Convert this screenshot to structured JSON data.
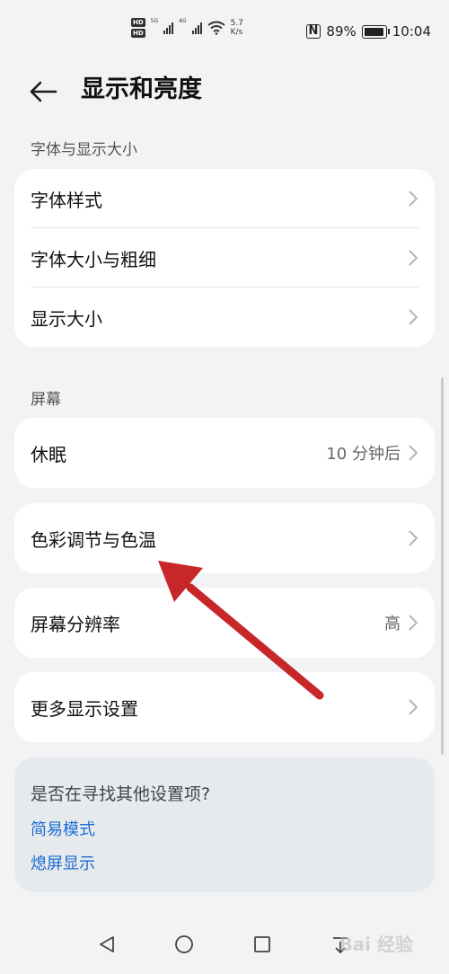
{
  "status_bar": {
    "hd1": "HD",
    "hd2": "HD",
    "net1": "5G",
    "net2": "4G",
    "speed_value": "5.7",
    "speed_unit": "K/s",
    "battery": "89%",
    "time": "10:04"
  },
  "header": {
    "title": "显示和亮度"
  },
  "section_font": {
    "label": "字体与显示大小",
    "items": [
      {
        "label": "字体样式"
      },
      {
        "label": "字体大小与粗细"
      },
      {
        "label": "显示大小"
      }
    ]
  },
  "section_screen": {
    "label": "屏幕",
    "sleep": {
      "label": "休眠",
      "value": "10 分钟后"
    },
    "color": {
      "label": "色彩调节与色温"
    },
    "resolution": {
      "label": "屏幕分辨率",
      "value": "高"
    },
    "more": {
      "label": "更多显示设置"
    }
  },
  "search_card": {
    "question": "是否在寻找其他设置项?",
    "links": [
      "简易模式",
      "熄屏显示"
    ]
  },
  "watermark": "Bai 经验",
  "colors": {
    "link": "#1a6bd6",
    "annotation_arrow": "#c8272a",
    "background": "#f1f3f5"
  }
}
